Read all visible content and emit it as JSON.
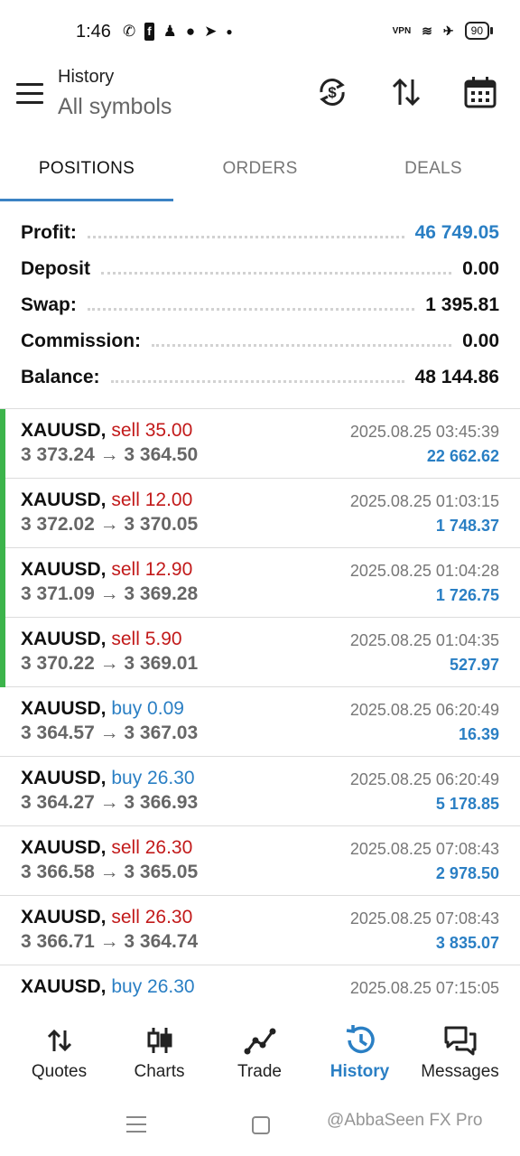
{
  "status_bar": {
    "time": "1:46",
    "left_icons": [
      "whatsapp-icon",
      "facebook-icon",
      "snapchat-icon",
      "chat-icon",
      "telegram-icon",
      "dot-icon"
    ],
    "vpn_label": "VPN",
    "battery": "90"
  },
  "header": {
    "title": "History",
    "subtitle": "All symbols"
  },
  "tabs": [
    {
      "label": "POSITIONS",
      "active": true
    },
    {
      "label": "ORDERS",
      "active": false
    },
    {
      "label": "DEALS",
      "active": false
    }
  ],
  "summary": {
    "profit_label": "Profit:",
    "profit_value": "46 749.05",
    "deposit_label": "Deposit",
    "deposit_value": "0.00",
    "swap_label": "Swap:",
    "swap_value": "1 395.81",
    "commission_label": "Commission:",
    "commission_value": "0.00",
    "balance_label": "Balance:",
    "balance_value": "48 144.86"
  },
  "deals": [
    {
      "symbol": "XAUUSD,",
      "type": "sell 35.00",
      "side": "sell",
      "prices": "3 373.24 → 3 364.50",
      "time": "2025.08.25 03:45:39",
      "profit": "22 662.62",
      "marked": true
    },
    {
      "symbol": "XAUUSD,",
      "type": "sell 12.00",
      "side": "sell",
      "prices": "3 372.02 → 3 370.05",
      "time": "2025.08.25 01:03:15",
      "profit": "1 748.37",
      "marked": true
    },
    {
      "symbol": "XAUUSD,",
      "type": "sell 12.90",
      "side": "sell",
      "prices": "3 371.09 → 3 369.28",
      "time": "2025.08.25 01:04:28",
      "profit": "1 726.75",
      "marked": true
    },
    {
      "symbol": "XAUUSD,",
      "type": "sell 5.90",
      "side": "sell",
      "prices": "3 370.22 → 3 369.01",
      "time": "2025.08.25 01:04:35",
      "profit": "527.97",
      "marked": true
    },
    {
      "symbol": "XAUUSD,",
      "type": "buy 0.09",
      "side": "buy",
      "prices": "3 364.57 → 3 367.03",
      "time": "2025.08.25 06:20:49",
      "profit": "16.39",
      "marked": false
    },
    {
      "symbol": "XAUUSD,",
      "type": "buy 26.30",
      "side": "buy",
      "prices": "3 364.27 → 3 366.93",
      "time": "2025.08.25 06:20:49",
      "profit": "5 178.85",
      "marked": false
    },
    {
      "symbol": "XAUUSD,",
      "type": "sell 26.30",
      "side": "sell",
      "prices": "3 366.58 → 3 365.05",
      "time": "2025.08.25 07:08:43",
      "profit": "2 978.50",
      "marked": false
    },
    {
      "symbol": "XAUUSD,",
      "type": "sell 26.30",
      "side": "sell",
      "prices": "3 366.71 → 3 364.74",
      "time": "2025.08.25 07:08:43",
      "profit": "3 835.07",
      "marked": false
    },
    {
      "symbol": "XAUUSD,",
      "type": "buy 26.30",
      "side": "buy",
      "prices": "",
      "time": "2025.08.25 07:15:05",
      "profit": "",
      "marked": false
    }
  ],
  "bottom_nav": [
    {
      "label": "Quotes",
      "icon": "quotes-icon",
      "active": false
    },
    {
      "label": "Charts",
      "icon": "charts-icon",
      "active": false
    },
    {
      "label": "Trade",
      "icon": "trade-icon",
      "active": false
    },
    {
      "label": "History",
      "icon": "history-icon",
      "active": true
    },
    {
      "label": "Messages",
      "icon": "messages-icon",
      "active": false
    }
  ],
  "watermark": "@AbbaSeen FX Pro",
  "colors": {
    "accent_blue": "#2a7fc4",
    "sell_red": "#c21a1a",
    "marker_green": "#3cb44b"
  }
}
